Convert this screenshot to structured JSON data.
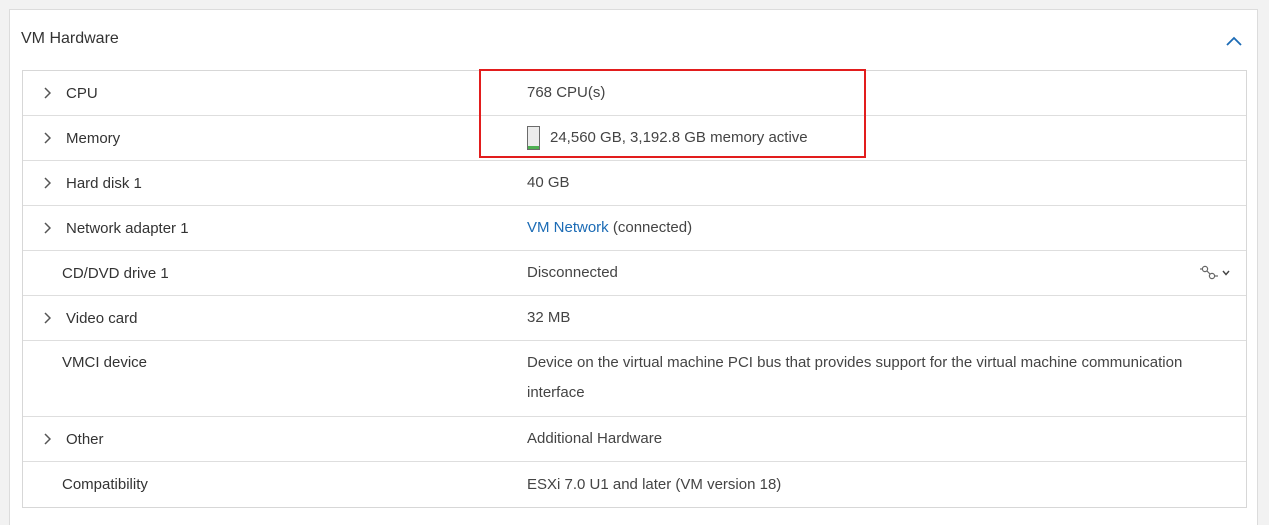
{
  "panel": {
    "title": "VM Hardware",
    "collapse_icon": "chevron-up-icon",
    "accent_color": "#1b6bb5"
  },
  "rows": [
    {
      "label": "CPU",
      "value": "768 CPU(s)",
      "expandable": true
    },
    {
      "label": "Memory",
      "value": "24,560 GB, 3,192.8 GB memory active",
      "expandable": true,
      "usage_icon": "memory-usage-icon",
      "usage_fraction": 0.13
    },
    {
      "label": "Hard disk 1",
      "value": "40 GB",
      "expandable": true
    },
    {
      "label": "Network adapter 1",
      "link": "VM Network",
      "value_suffix": " (connected)",
      "expandable": true
    },
    {
      "label": "CD/DVD drive 1",
      "value": "Disconnected",
      "expandable": false,
      "action_icon": "connect-plug-icon"
    },
    {
      "label": "Video card",
      "value": "32 MB",
      "expandable": true
    },
    {
      "label": "VMCI device",
      "value": "Device on the virtual machine PCI bus that provides support for the virtual machine communication interface",
      "expandable": false
    },
    {
      "label": "Other",
      "value": "Additional Hardware",
      "expandable": true
    },
    {
      "label": "Compatibility",
      "value": "ESXi 7.0 U1 and later (VM version 18)",
      "expandable": false
    }
  ],
  "highlight_color": "#e21d1d"
}
